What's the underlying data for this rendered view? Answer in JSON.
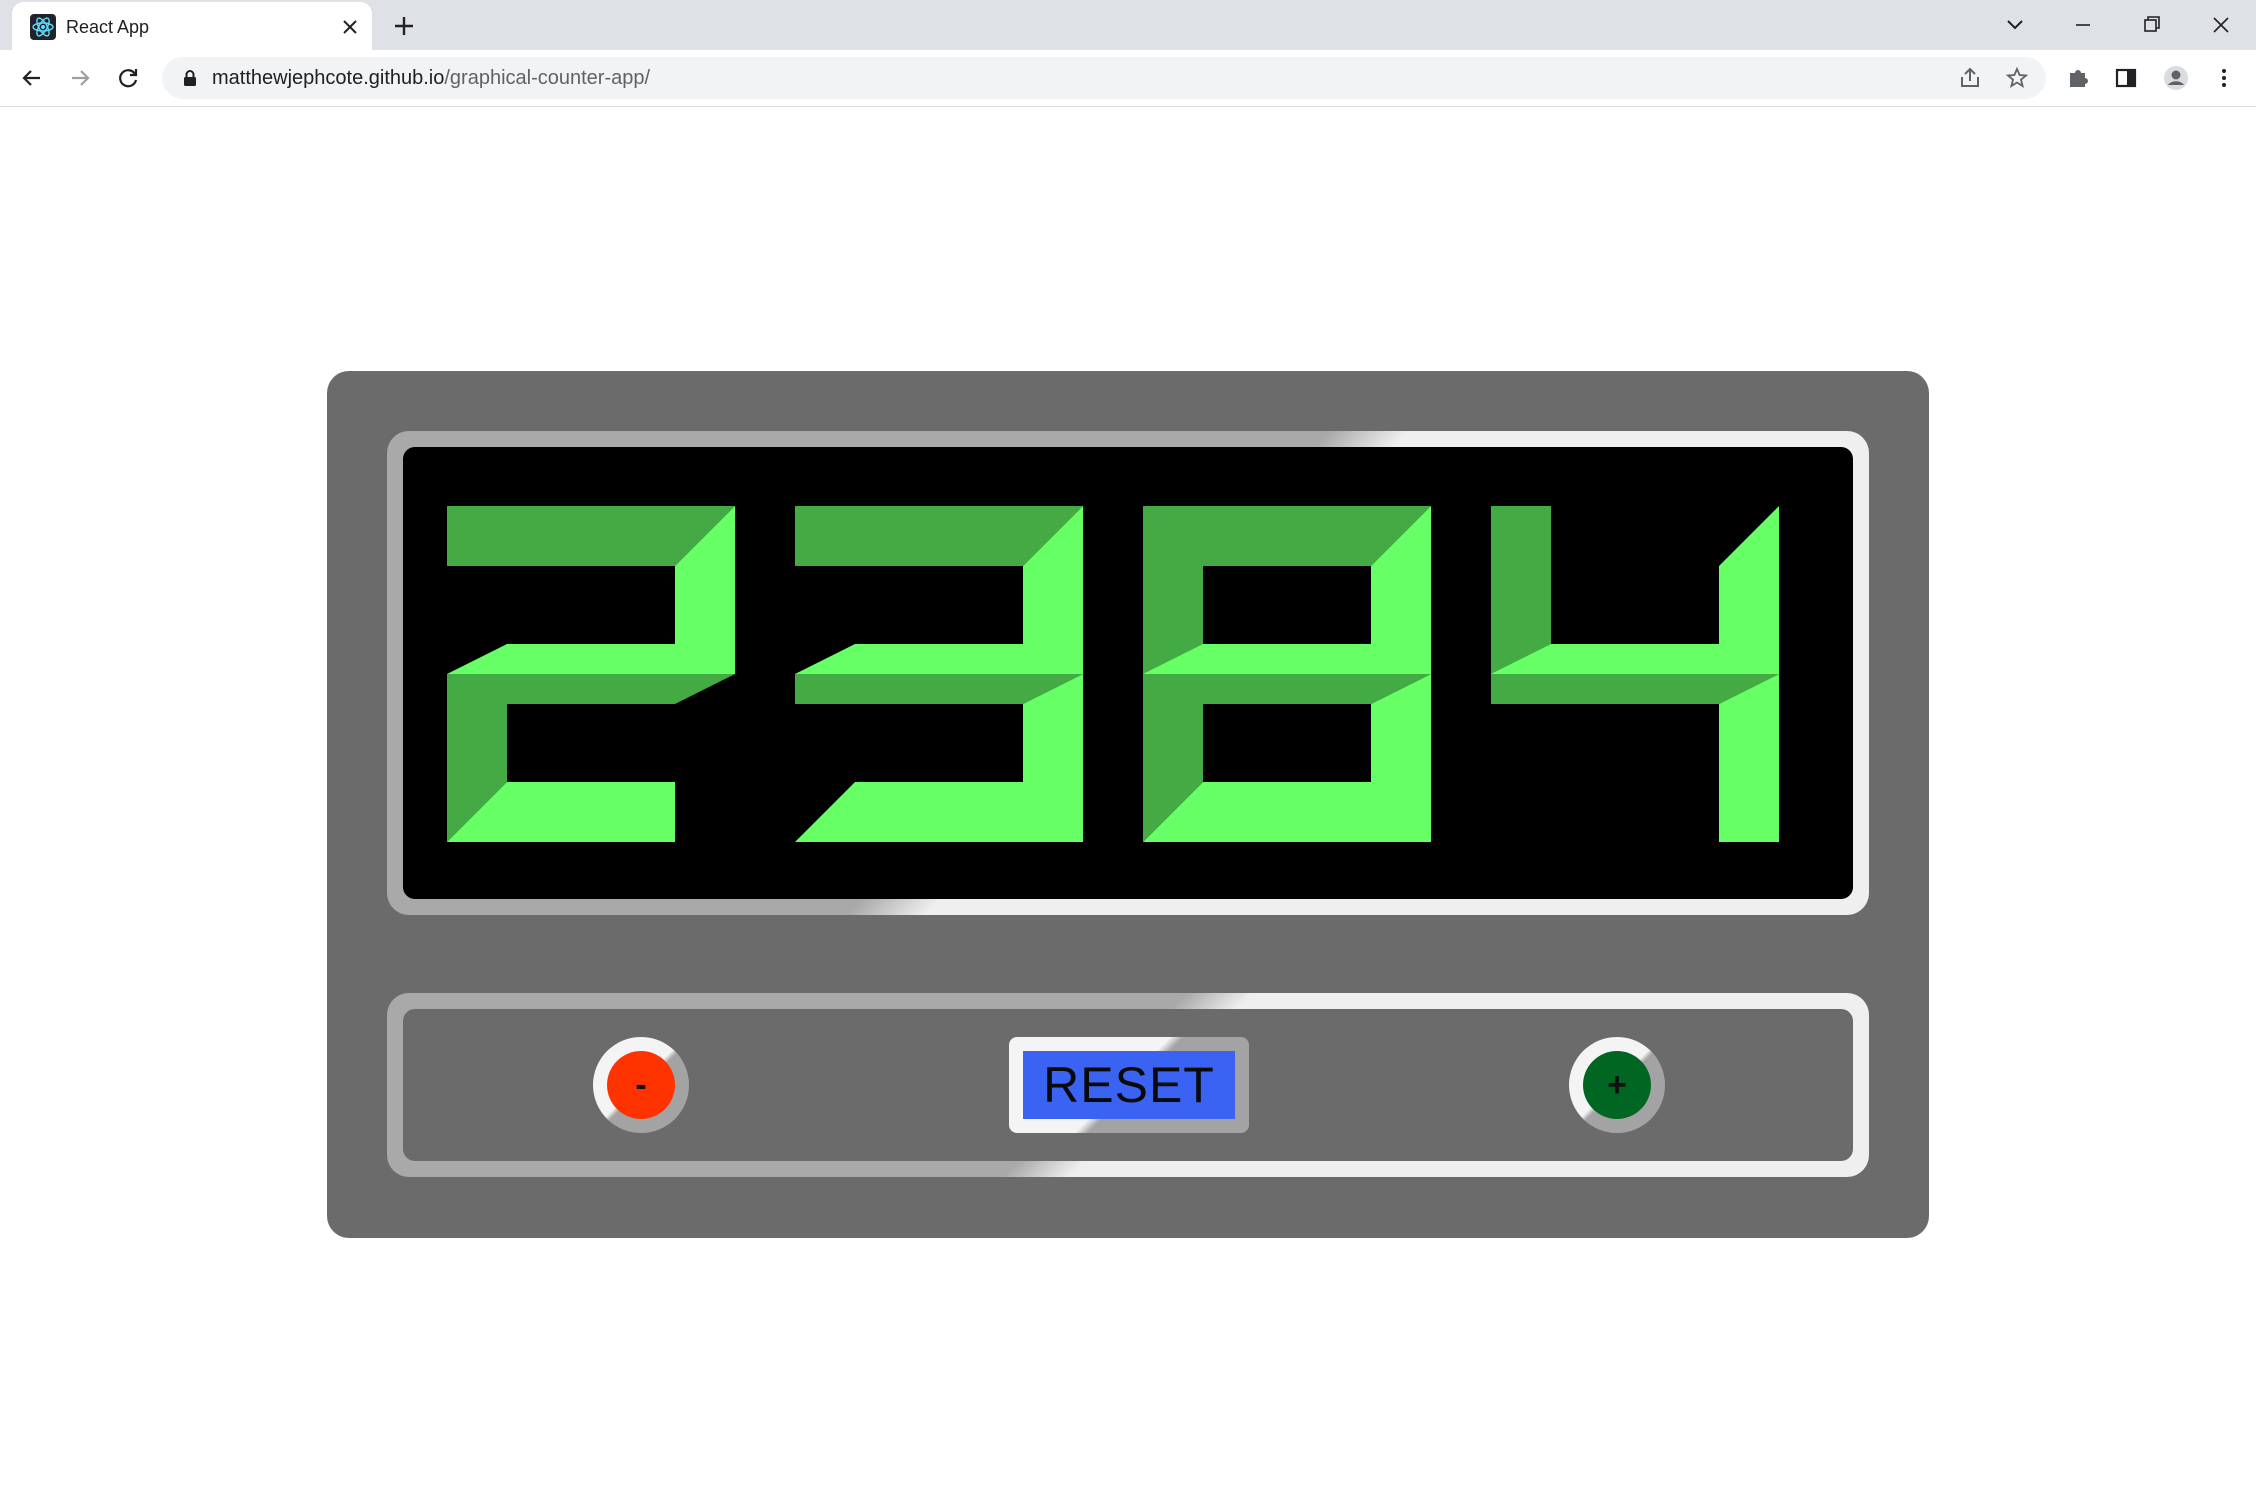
{
  "browser": {
    "tab_title": "React App",
    "url_host": "matthewjephcote.github.io",
    "url_path": "/graphical-counter-app/"
  },
  "colors": {
    "device": "#6b6b6b",
    "display": "#000000",
    "segment_bright": "#66ff66",
    "segment_dark": "#44aa44",
    "decrement": "#ff3300",
    "increment": "#006622",
    "reset": "#3a63f4"
  },
  "counter": {
    "value": "2384",
    "digits": [
      "2",
      "3",
      "8",
      "4"
    ]
  },
  "controls": {
    "decrement_label": "-",
    "reset_label": "RESET",
    "increment_label": "+"
  }
}
